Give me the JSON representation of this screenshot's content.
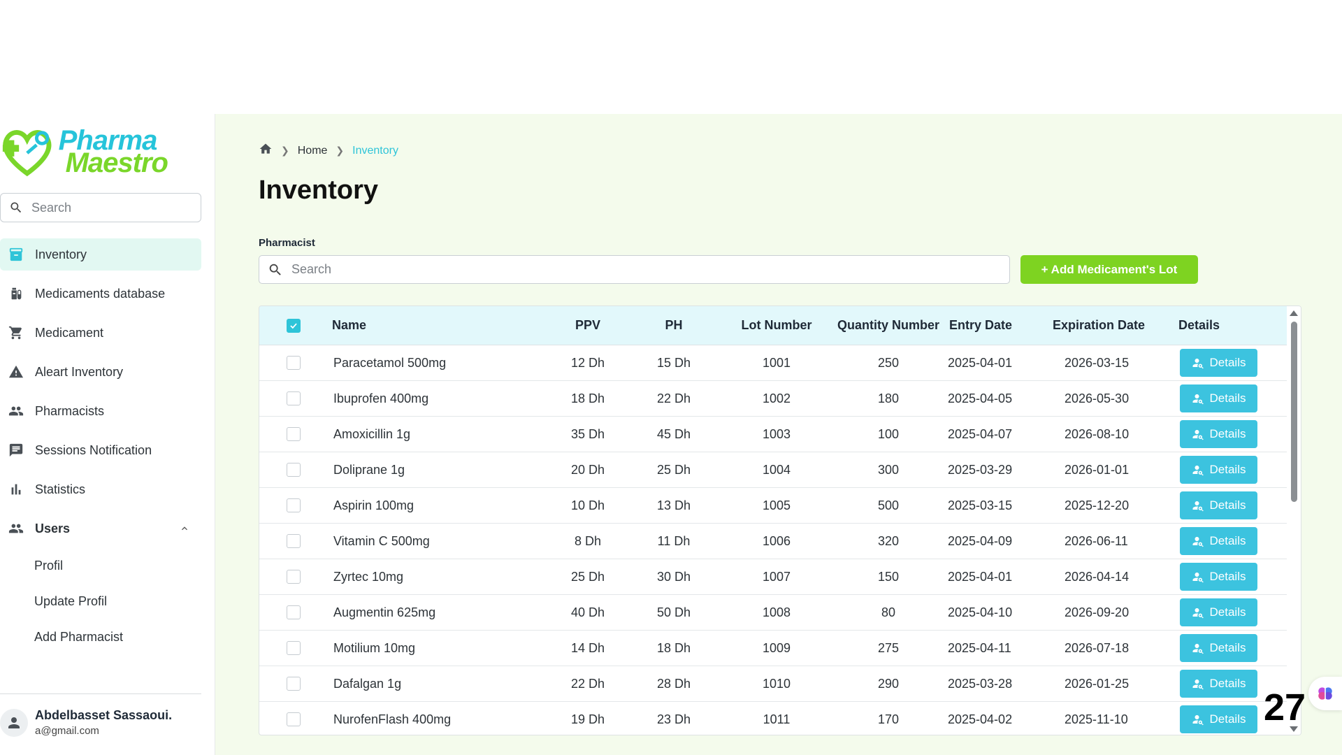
{
  "brand": {
    "line1": "Pharma",
    "line2": "Maestro"
  },
  "sidebar": {
    "search_placeholder": "Search",
    "items": [
      {
        "label": "Inventory",
        "icon": "inventory-icon",
        "active": true
      },
      {
        "label": "Medicaments database",
        "icon": "medication-icon"
      },
      {
        "label": "Medicament",
        "icon": "cart-icon"
      },
      {
        "label": "Aleart Inventory",
        "icon": "warning-icon"
      },
      {
        "label": "Pharmacists",
        "icon": "people-icon"
      },
      {
        "label": "Sessions Notification",
        "icon": "chat-icon"
      },
      {
        "label": "Statistics",
        "icon": "bar-chart-icon"
      }
    ],
    "users": {
      "label": "Users",
      "sub_items": [
        "Profil",
        "Update Profil",
        "Add Pharmacist"
      ]
    },
    "user": {
      "name": "Abdelbasset Sassaoui.",
      "email": "a@gmail.com"
    }
  },
  "breadcrumb": {
    "home": "Home",
    "current": "Inventory"
  },
  "page_title": "Inventory",
  "filter": {
    "label": "Pharmacist",
    "placeholder": "Search"
  },
  "add_button": "+ Add Medicament's Lot",
  "table": {
    "headers": [
      "Name",
      "PPV",
      "PH",
      "Lot Number",
      "Quantity Number",
      "Entry Date",
      "Expiration Date",
      "Details"
    ],
    "details_label": "Details",
    "rows": [
      {
        "name": "Paracetamol 500mg",
        "ppv": "12 Dh",
        "ph": "15 Dh",
        "lot": "1001",
        "qty": "250",
        "entry": "2025-04-01",
        "exp": "2026-03-15"
      },
      {
        "name": "Ibuprofen 400mg",
        "ppv": "18 Dh",
        "ph": "22 Dh",
        "lot": "1002",
        "qty": "180",
        "entry": "2025-04-05",
        "exp": "2026-05-30"
      },
      {
        "name": "Amoxicillin 1g",
        "ppv": "35 Dh",
        "ph": "45 Dh",
        "lot": "1003",
        "qty": "100",
        "entry": "2025-04-07",
        "exp": "2026-08-10"
      },
      {
        "name": "Doliprane 1g",
        "ppv": "20 Dh",
        "ph": "25 Dh",
        "lot": "1004",
        "qty": "300",
        "entry": "2025-03-29",
        "exp": "2026-01-01"
      },
      {
        "name": "Aspirin 100mg",
        "ppv": "10 Dh",
        "ph": "13 Dh",
        "lot": "1005",
        "qty": "500",
        "entry": "2025-03-15",
        "exp": "2025-12-20"
      },
      {
        "name": "Vitamin C 500mg",
        "ppv": "8 Dh",
        "ph": "11 Dh",
        "lot": "1006",
        "qty": "320",
        "entry": "2025-04-09",
        "exp": "2026-06-11"
      },
      {
        "name": "Zyrtec 10mg",
        "ppv": "25 Dh",
        "ph": "30 Dh",
        "lot": "1007",
        "qty": "150",
        "entry": "2025-04-01",
        "exp": "2026-04-14"
      },
      {
        "name": "Augmentin 625mg",
        "ppv": "40 Dh",
        "ph": "50 Dh",
        "lot": "1008",
        "qty": "80",
        "entry": "2025-04-10",
        "exp": "2026-09-20"
      },
      {
        "name": "Motilium 10mg",
        "ppv": "14 Dh",
        "ph": "18 Dh",
        "lot": "1009",
        "qty": "275",
        "entry": "2025-04-11",
        "exp": "2026-07-18"
      },
      {
        "name": "Dafalgan 1g",
        "ppv": "22 Dh",
        "ph": "28 Dh",
        "lot": "1010",
        "qty": "290",
        "entry": "2025-03-28",
        "exp": "2026-01-25"
      },
      {
        "name": "NurofenFlash 400mg",
        "ppv": "19 Dh",
        "ph": "23 Dh",
        "lot": "1011",
        "qty": "170",
        "entry": "2025-04-02",
        "exp": "2025-11-10"
      }
    ]
  },
  "page_count": "27",
  "colors": {
    "accent": "#2ec4d8",
    "add_button": "#7ed321",
    "main_bg": "#f4fbec",
    "active_nav": "#e2f8f2"
  }
}
